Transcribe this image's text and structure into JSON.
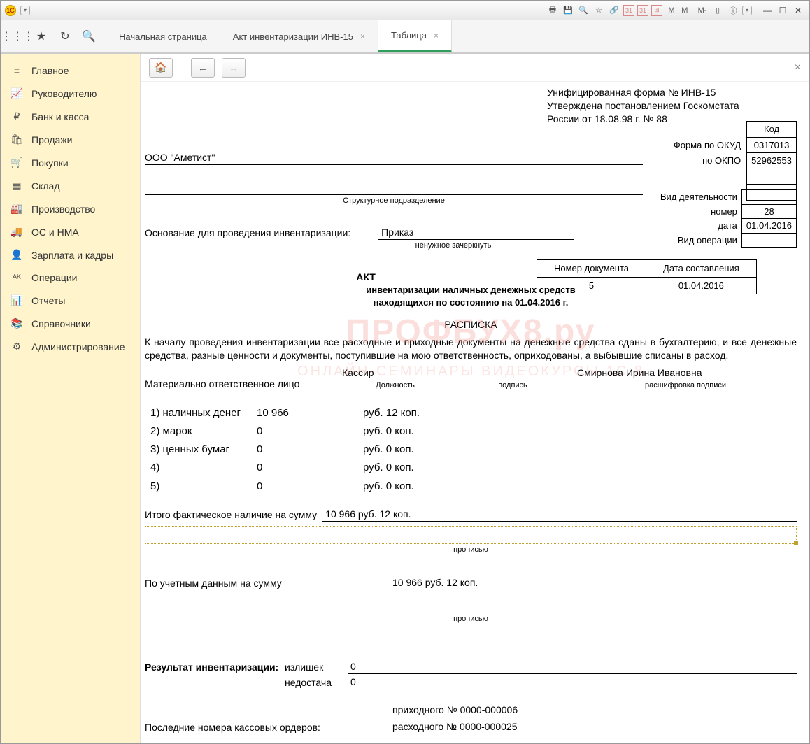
{
  "titlebar": {
    "icons": [
      "print",
      "preview",
      "search",
      "star",
      "cal1",
      "cal2",
      "cal3",
      "M",
      "M+",
      "M-",
      "panel",
      "info"
    ]
  },
  "tabs": {
    "start": "Начальная страница",
    "t1": "Акт инвентаризации ИНВ-15",
    "t2": "Таблица"
  },
  "sidebar": {
    "items": [
      {
        "icon": "≡",
        "label": "Главное"
      },
      {
        "icon": "📈",
        "label": "Руководителю"
      },
      {
        "icon": "₽",
        "label": "Банк и касса"
      },
      {
        "icon": "🛍",
        "label": "Продажи"
      },
      {
        "icon": "🛒",
        "label": "Покупки"
      },
      {
        "icon": "▦",
        "label": "Склад"
      },
      {
        "icon": "🏭",
        "label": "Производство"
      },
      {
        "icon": "🚚",
        "label": "ОС и НМА"
      },
      {
        "icon": "👤",
        "label": "Зарплата и кадры"
      },
      {
        "icon": "ᴬᴷ",
        "label": "Операции"
      },
      {
        "icon": "📊",
        "label": "Отчеты"
      },
      {
        "icon": "📚",
        "label": "Справочники"
      },
      {
        "icon": "⚙",
        "label": "Администрирование"
      }
    ]
  },
  "doc": {
    "approval1": "Унифицированная форма №  ИНВ-15",
    "approval2": "Утверждена постановлением Госкомстата",
    "approval3": "России от 18.08.98 г. № 88",
    "kod_label": "Код",
    "okud_label": "Форма по ОКУД",
    "okud": "0317013",
    "okpo_label": "по ОКПО",
    "okpo": "52962553",
    "org": "ООО \"Аметист\"",
    "struct_label": "Структурное подразделение",
    "basis_label": "Основание для проведения инвентаризации:",
    "basis_val": "Приказ",
    "basis_note": "ненужное зачеркнуть",
    "vid_deyat": "Вид деятельности",
    "nomer_lbl": "номер",
    "nomer": "28",
    "data_lbl": "дата",
    "data": "01.04.2016",
    "vid_op": "Вид операции",
    "docnum_hdr": "Номер документа",
    "docdate_hdr": "Дата составления",
    "docnum": "5",
    "docdate": "01.04.2016",
    "act": "АКТ",
    "act_sub1": "инвентаризации наличных денежных средств",
    "act_sub2": "находящихся по состоянию на 01.04.2016 г.",
    "raspiska": "РАСПИСКА",
    "body": "К началу проведения инвентаризации все расходные и приходные документы на денежные средства сданы в бухгалтерию, и все денежные средства, разные ценности и документы, поступившие на мою ответственность, оприходованы, а выбывшие списаны в расход.",
    "mol": "Материально ответственное лицо",
    "dolzh": "Кассир",
    "dolzh_sub": "Должность",
    "podpis_sub": "подпись",
    "fio": "Смирнова Ирина Ивановна",
    "fio_sub": "расшифровка подписи",
    "items": [
      {
        "n": "1) наличных денег",
        "rub": "10 966",
        "kop": "12"
      },
      {
        "n": "2) марок",
        "rub": "0",
        "kop": "0"
      },
      {
        "n": "3) ценных бумаг",
        "rub": "0",
        "kop": "0"
      },
      {
        "n": "4)",
        "rub": "0",
        "kop": "0"
      },
      {
        "n": "5)",
        "rub": "0",
        "kop": "0"
      }
    ],
    "rub_w": "руб.",
    "kop_w": "коп.",
    "total_lbl": "Итого  фактическое  наличие  на  сумму",
    "total_val": "10 966 руб. 12 коп.",
    "propis": "прописью",
    "uchet_lbl": "По  учетным  данным  на  сумму",
    "uchet_val": "10 966 руб. 12 коп.",
    "result_lbl": "Результат инвентаризации:",
    "izl_lbl": "излишек",
    "izl": "0",
    "ned_lbl": "недостача",
    "ned": "0",
    "orders_lbl": "Последние номера кассовых ордеров:",
    "prih_lbl": "приходного № 0000-000006",
    "rash_lbl": "расходного № 0000-000025"
  },
  "watermark": "ПРОФБУХ8.ру",
  "watermark2": "ОНЛАЙН-СЕМИНАРЫ    ВИДЕОКУРСЫ 1С:8"
}
